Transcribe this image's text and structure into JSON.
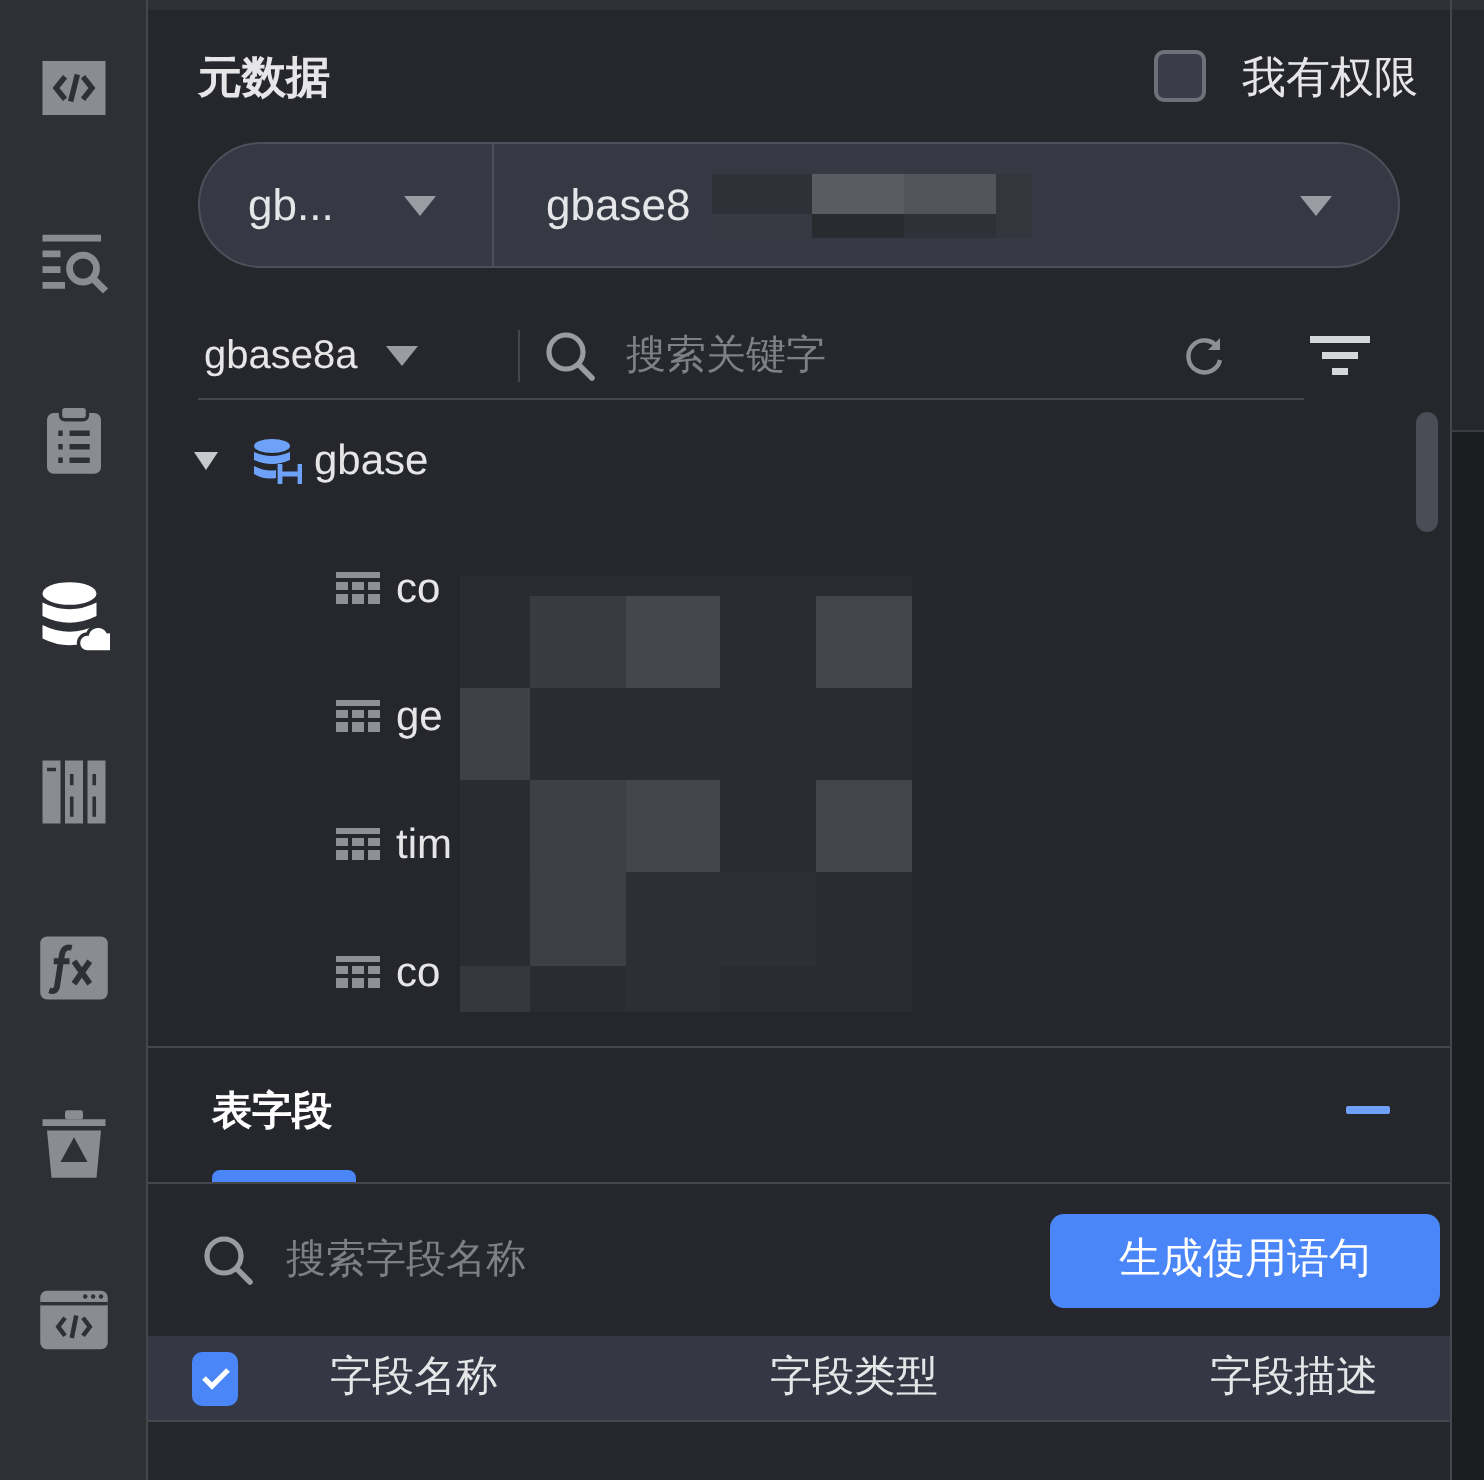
{
  "sidebar": {
    "items": [
      {
        "kind": "code",
        "selected": false
      },
      {
        "kind": "search-list",
        "selected": false
      },
      {
        "kind": "clipboard",
        "selected": false
      },
      {
        "kind": "database",
        "selected": true
      },
      {
        "kind": "columns",
        "selected": false
      },
      {
        "kind": "function",
        "selected": false
      },
      {
        "kind": "trash",
        "selected": false
      },
      {
        "kind": "browser-code",
        "selected": false
      }
    ]
  },
  "metadata": {
    "title": "元数据",
    "permission": {
      "label": "我有权限",
      "checked": false
    },
    "source": {
      "type": "gb...",
      "connection": "gbase8"
    },
    "schema": "gbase8a",
    "search": {
      "placeholder": "搜索关键字"
    },
    "tree": [
      {
        "label": "gbase",
        "expanded": true,
        "children": [
          {
            "label": "co"
          },
          {
            "label": "ge"
          },
          {
            "label": "tim"
          },
          {
            "label": "co"
          }
        ]
      }
    ]
  },
  "fields": {
    "tabs": [
      {
        "label": "表字段",
        "selected": true
      }
    ],
    "search": {
      "placeholder": "搜索字段名称"
    },
    "button": "生成使用语句",
    "table": {
      "select_all": {
        "checked": true
      },
      "columns": [
        "字段名称",
        "字段类型",
        "字段描述"
      ]
    }
  }
}
